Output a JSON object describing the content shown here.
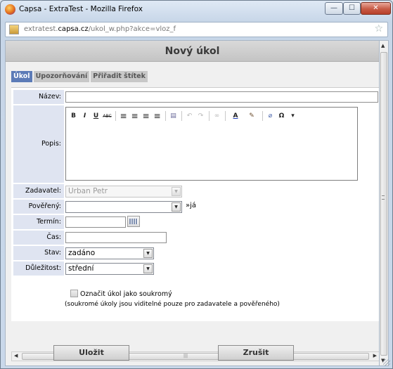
{
  "window": {
    "title": "Capsa - ExtraTest - Mozilla Firefox",
    "buttons": {
      "min": "—",
      "max": "☐",
      "close": "✕"
    }
  },
  "urlbar": {
    "prefix": "extratest.",
    "domain": "capsa.cz",
    "path": "/ukol_w.php?akce=vloz_f"
  },
  "page": {
    "title": "Nový úkol",
    "tabs": [
      {
        "label": "Úkol",
        "active": true
      },
      {
        "label": "Upozorňování",
        "active": false
      },
      {
        "label": "Přiřadit štítek",
        "active": false
      }
    ]
  },
  "form": {
    "labels": {
      "nazev": "Název:",
      "popis": "Popis:",
      "zadavatel": "Zadavatel:",
      "povereny": "Pověřený:",
      "termin": "Termín:",
      "cas": "Čas:",
      "stav": "Stav:",
      "dulezitost": "Důležitost:"
    },
    "values": {
      "nazev": "",
      "zadavatel": "Urban Petr",
      "povereny": "",
      "termin": "",
      "cas": "",
      "stav": "zadáno",
      "dulezitost": "střední"
    },
    "povereny_link": "»já",
    "editor_toolbar": [
      {
        "name": "bold",
        "glyph": "B"
      },
      {
        "name": "italic",
        "glyph": "I"
      },
      {
        "name": "underline",
        "glyph": "U"
      },
      {
        "name": "strikethrough",
        "glyph": "ABC"
      },
      {
        "name": "align-left",
        "glyph": "≡"
      },
      {
        "name": "align-center",
        "glyph": "≡"
      },
      {
        "name": "align-right",
        "glyph": "≡"
      },
      {
        "name": "align-justify",
        "glyph": "≡"
      },
      {
        "name": "paste",
        "glyph": "▤"
      },
      {
        "name": "undo",
        "glyph": "↶"
      },
      {
        "name": "redo",
        "glyph": "↷"
      },
      {
        "name": "link",
        "glyph": "∞"
      },
      {
        "name": "font-color",
        "glyph": "A"
      },
      {
        "name": "highlight",
        "glyph": "✎"
      },
      {
        "name": "remove-format",
        "glyph": "⌀"
      },
      {
        "name": "special-char",
        "glyph": "Ω"
      },
      {
        "name": "more",
        "glyph": "▾"
      }
    ],
    "private_checkbox": "Označit úkol jako soukromý",
    "private_note": "(soukromé úkoly jsou viditelné pouze pro zadavatele a pověřeného)"
  },
  "actions": {
    "save": "Uložit",
    "cancel": "Zrušit"
  },
  "colors": {
    "active_tab": "#5c7bb7",
    "label_bg": "#dfe4f1",
    "page_bg": "#f0f0f0"
  }
}
